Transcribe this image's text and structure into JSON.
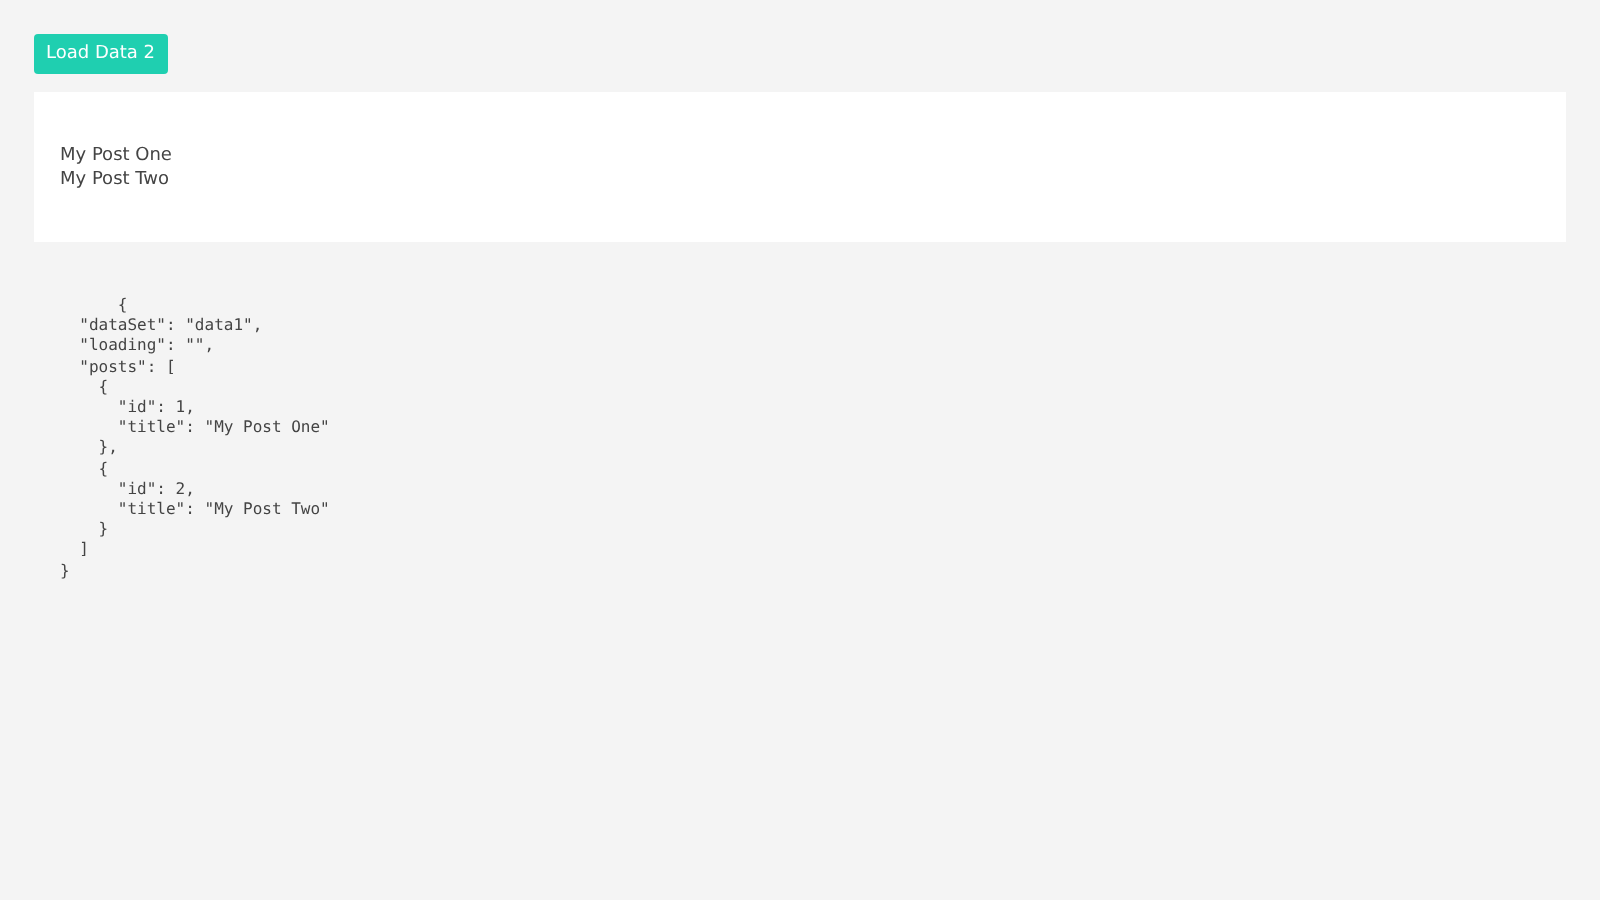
{
  "button": {
    "label": "Load Data 2"
  },
  "posts": [
    "My Post One",
    "My Post Two"
  ],
  "json_dump": "      {\n  \"dataSet\": \"data1\",\n  \"loading\": \"\",\n  \"posts\": [\n    {\n      \"id\": 1,\n      \"title\": \"My Post One\"\n    },\n    {\n      \"id\": 2,\n      \"title\": \"My Post Two\"\n    }\n  ]\n}"
}
